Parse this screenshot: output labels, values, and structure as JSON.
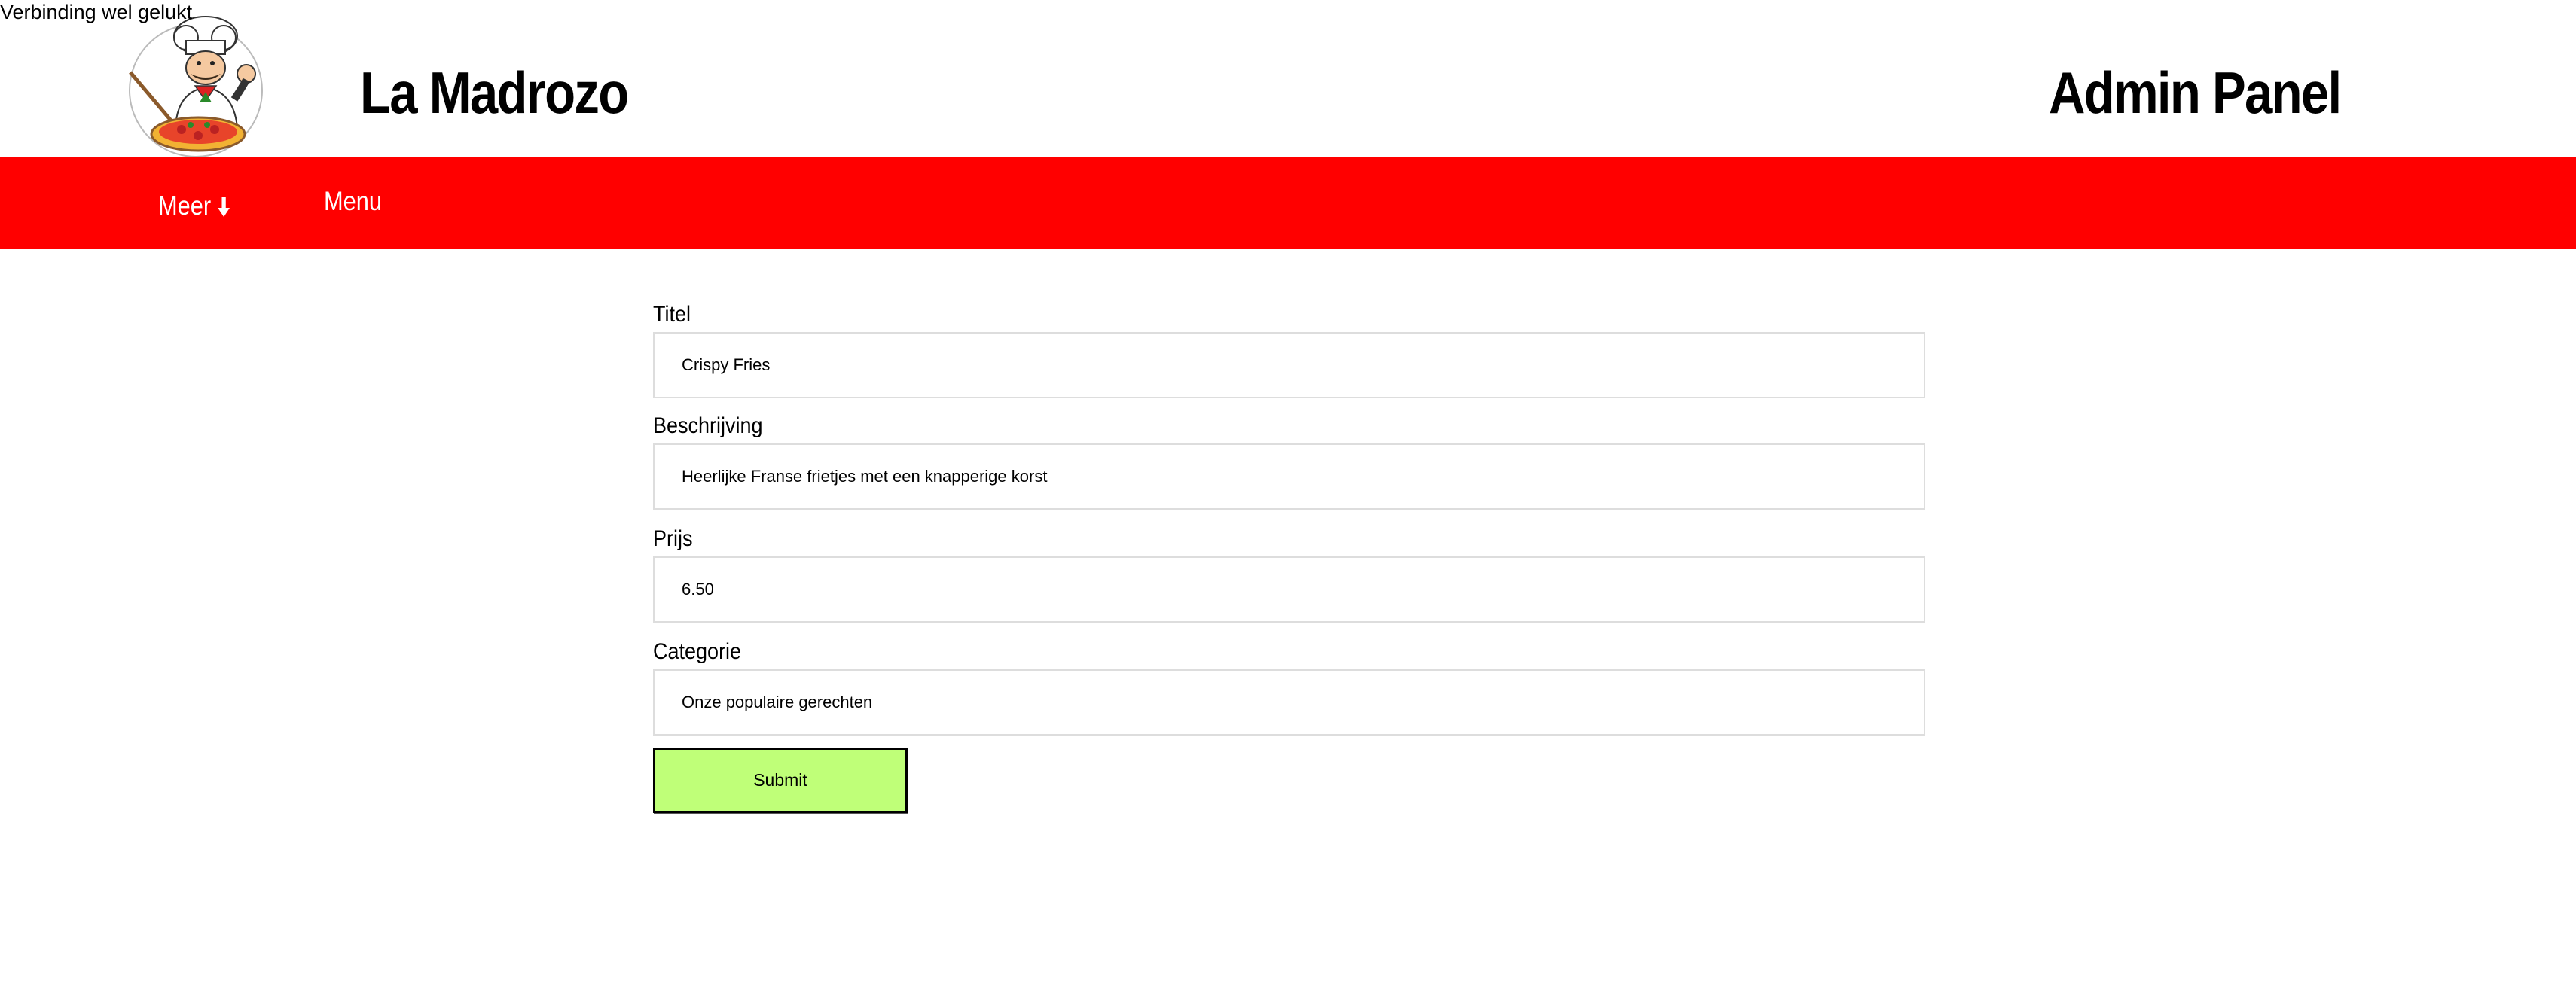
{
  "status": "Verbinding wel gelukt",
  "header": {
    "site_title": "La Madrozo",
    "admin_title": "Admin Panel",
    "logo_icon": "chef-pizza-logo"
  },
  "nav": {
    "items": [
      {
        "label": "Meer",
        "icon": "arrow-down-icon"
      },
      {
        "label": "Menu"
      }
    ]
  },
  "form": {
    "fields": [
      {
        "label": "Titel",
        "value": "Crispy Fries"
      },
      {
        "label": "Beschrijving",
        "value": "Heerlijke Franse frietjes met een knapperige korst"
      },
      {
        "label": "Prijs",
        "value": "6.50"
      },
      {
        "label": "Categorie",
        "value": "Onze populaire gerechten"
      }
    ],
    "submit_label": "Submit"
  },
  "colors": {
    "nav_bg": "#ff0000",
    "submit_bg": "#bfff78",
    "input_border": "#dddddd"
  }
}
